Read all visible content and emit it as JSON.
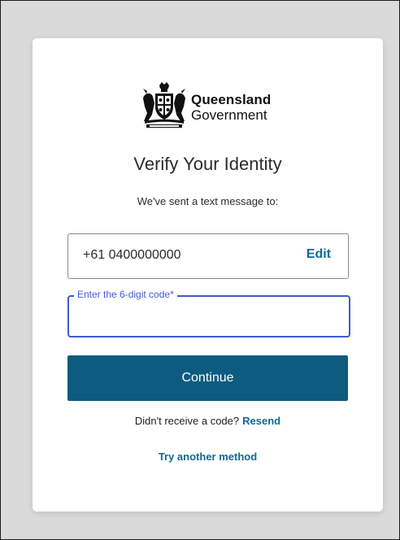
{
  "brand": {
    "line1": "Queensland",
    "line2": "Government",
    "crest_icon": "queensland-coat-of-arms-icon"
  },
  "title": "Verify Your Identity",
  "subtitle": "We've sent a text message to:",
  "phone": {
    "number": "+61 0400000000",
    "edit_label": "Edit"
  },
  "code_field": {
    "label": "Enter the 6-digit code*",
    "value": ""
  },
  "continue_label": "Continue",
  "resend": {
    "prompt": "Didn't receive a code?",
    "link_label": "Resend"
  },
  "try_another_label": "Try another method",
  "colors": {
    "page_background": "#dadada",
    "card_background": "#ffffff",
    "primary_button": "#0d5c7f",
    "link": "#0f6a90",
    "focus_border": "#3f5bd1"
  }
}
